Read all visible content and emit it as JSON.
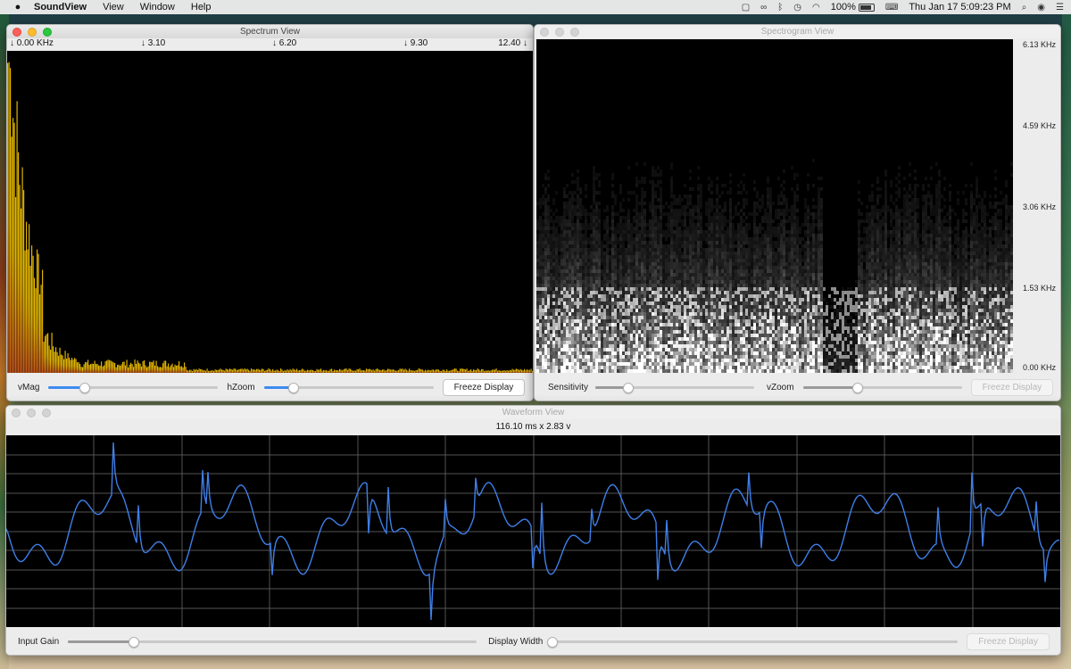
{
  "menubar": {
    "apple": "",
    "app_name": "SoundView",
    "menus": [
      "View",
      "Window",
      "Help"
    ],
    "battery": "100%",
    "datetime": "Thu Jan 17  5:09:23 PM"
  },
  "spectrum_window": {
    "title": "Spectrum View",
    "freq_labels": [
      "↓ 0.00 KHz",
      "↓ 3.10",
      "↓ 6.20",
      "↓ 9.30",
      "12.40 ↓"
    ],
    "vmag_label": "vMag",
    "vmag_value": 0.21,
    "hzoom_label": "hZoom",
    "hzoom_value": 0.17,
    "freeze_label": "Freeze Display"
  },
  "spectrogram_window": {
    "title": "Spectrogram View",
    "scale_labels": [
      "6.13 KHz",
      "4.59 KHz",
      "3.06 KHz",
      "1.53 KHz",
      "0.00 KHz"
    ],
    "sensitivity_label": "Sensitivity",
    "sensitivity_value": 0.2,
    "vzoom_label": "vZoom",
    "vzoom_value": 0.34,
    "freeze_label": "Freeze Display"
  },
  "waveform_window": {
    "title": "Waveform View",
    "readout": "116.10 ms x 2.83 v",
    "input_gain_label": "Input Gain",
    "input_gain_value": 0.16,
    "display_width_label": "Display Width",
    "display_width_value": 0.0,
    "freeze_label": "Freeze Display"
  },
  "colors": {
    "spectrum_bar": "#e0b400",
    "spectrum_bar_base": "#c0541a",
    "waveform_line": "#3f7fe8",
    "grid_line": "#555555",
    "slider_accent": "#3d8bf0"
  }
}
